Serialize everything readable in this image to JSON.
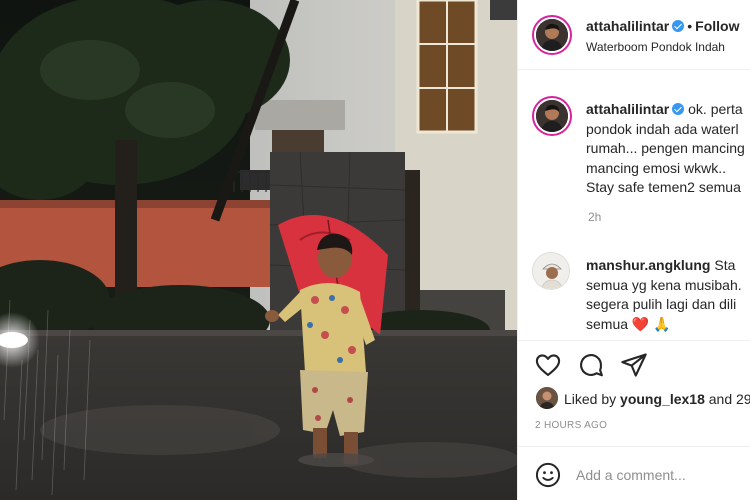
{
  "post": {
    "username": "attahalilintar",
    "follow_label": "Follow",
    "separator": "•",
    "location": "Waterboom Pondok Indah"
  },
  "caption": {
    "username": "attahalilintar",
    "line1_tail": "ok. perta",
    "lines": [
      "pondok indah ada waterl",
      "rumah... pengen mancing",
      "mancing emosi wkwk..",
      "Stay safe temen2 semua"
    ],
    "time": "2h"
  },
  "comment": {
    "username": "manshur.angklung",
    "line1_tail": "Sta",
    "lines": [
      "semua yg kena musibah.",
      "segera pulih lagi dan dili",
      "semua"
    ],
    "emojis": [
      "❤️",
      "🙏"
    ]
  },
  "actions": {
    "icons": [
      "heart-icon",
      "comment-icon",
      "share-icon"
    ]
  },
  "likes": {
    "prefix": "Liked by",
    "user": "young_lex18",
    "suffix": "and 29"
  },
  "timestamp": "2 HOURS AGO",
  "add_comment": {
    "placeholder": "Add a comment..."
  },
  "colors": {
    "verified": "#3897f0",
    "umbrella": "#d8323e",
    "story_ring": "#d6249f"
  }
}
